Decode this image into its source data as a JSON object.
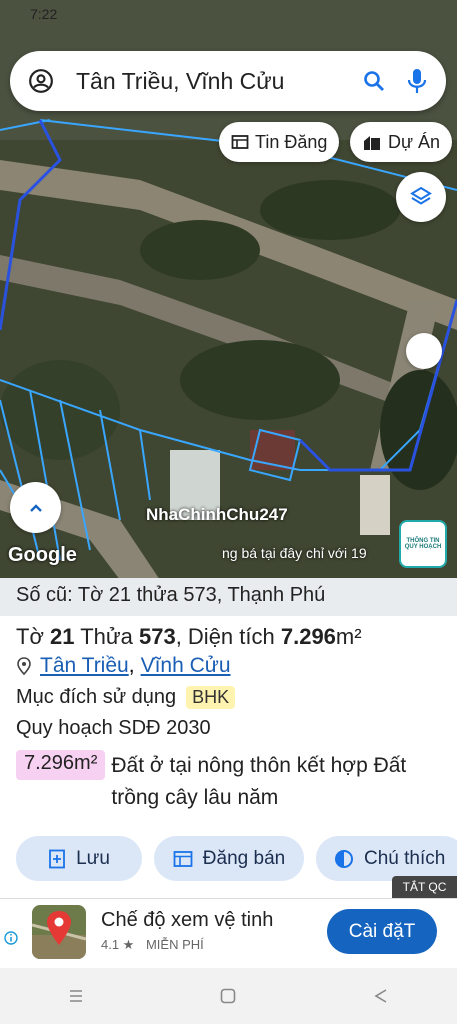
{
  "status": {
    "time": "7:22"
  },
  "search": {
    "query": "Tân Triều, Vĩnh Cửu"
  },
  "chips": {
    "listing": "Tin Đăng",
    "project": "Dự Án"
  },
  "map": {
    "watermark": "NhaChinhChu247",
    "provider": "Google",
    "ticker": "ng bá tại đây chỉ với 19",
    "badge": "THÔNG TIN QUY HOẠCH"
  },
  "parcel": {
    "old_number": "Số cũ: Tờ 21 thửa 573, Thạnh Phú",
    "sheet_label": "Tờ",
    "sheet": "21",
    "lot_label": "Thửa",
    "lot": "573",
    "area_label": ", Diện tích",
    "area": "7.296",
    "unit": "m²",
    "location_1": "Tân Triều",
    "location_2": "Vĩnh Cửu",
    "purpose_label": "Mục đích sử dụng",
    "purpose_code": "BHK",
    "plan_label": "Quy hoạch SDĐ 2030",
    "plan_area": "7.296m²",
    "plan_desc": "Đất ở tại nông thôn kết hợp Đất trồng cây lâu năm"
  },
  "actions": {
    "save": "Lưu",
    "sell": "Đăng bán",
    "legend": "Chú thích"
  },
  "ad": {
    "close": "TẮT QC",
    "app_name": "Chế độ xem vệ tinh",
    "rating": "4.1 ★",
    "price": "MIỄN PHÍ",
    "install": "Cài đặT"
  },
  "colors": {
    "accent": "#1565c0",
    "chip_bg": "#dbe6f7",
    "tag_bg": "#fff3b0",
    "area_bg": "#f7d1f2"
  }
}
